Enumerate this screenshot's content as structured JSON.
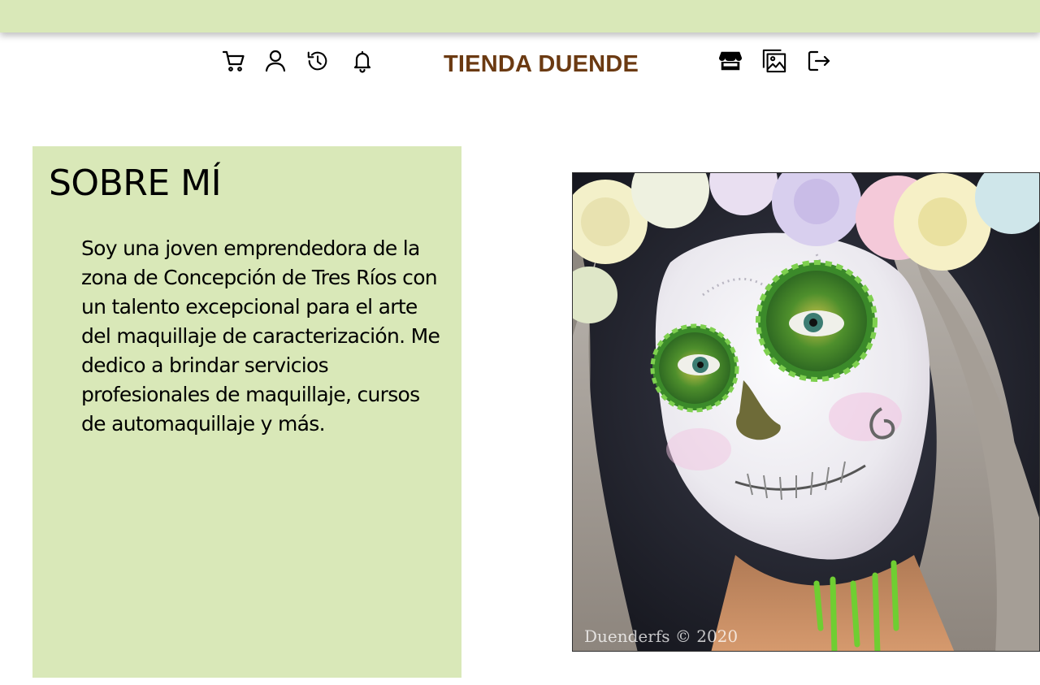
{
  "header": {
    "brand": "TIENDA DUENDE",
    "brand_color": "#6b3a12",
    "bar_color": "#d9e8b8",
    "icons_left": [
      "cart-icon",
      "user-icon",
      "history-icon",
      "bell-icon"
    ],
    "icons_right": [
      "store-icon",
      "gallery-icon",
      "logout-icon"
    ]
  },
  "about": {
    "title": "SOBRE MÍ",
    "body": "Soy una joven emprendedora de la zona de Concepción de Tres Ríos con un talento excepcional para el arte del maquillaje de caracterización. Me dedico a brindar servicios profesionales de maquillaje, cursos de automaquillaje y más.",
    "card_color": "#d9e8b8"
  },
  "photo": {
    "watermark": "Duenderfs © 2020"
  }
}
